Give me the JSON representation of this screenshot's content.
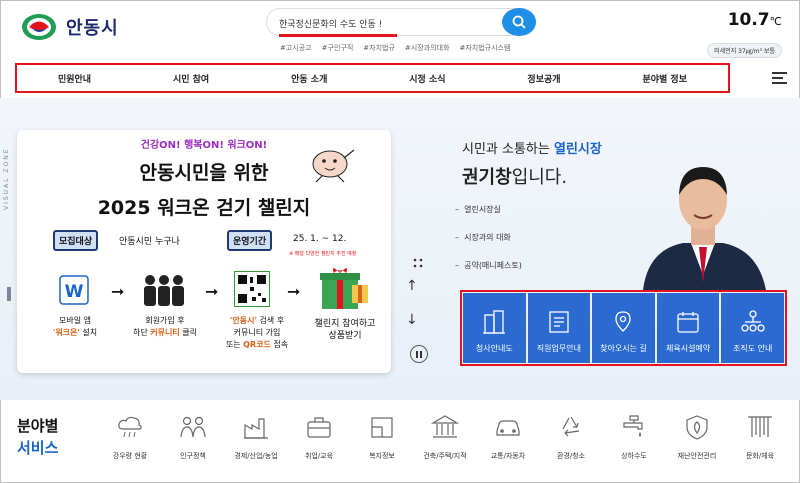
{
  "header": {
    "logo_text": "안동시",
    "search": {
      "value": "한국정신문화의 수도 안동 !"
    },
    "hashtags": [
      "#고시공고",
      "#구인구직",
      "#자치법규",
      "#시장과의대화",
      "#자치법규시스템"
    ],
    "weather": {
      "temperature": "10.7",
      "unit": "℃",
      "dust": "미세먼지 37㎍/m³ 보통"
    }
  },
  "nav": {
    "items": [
      "민원안내",
      "시민 참여",
      "안동 소개",
      "시정 소식",
      "정보공개",
      "분야별 정보"
    ]
  },
  "banner": {
    "kicker": "건강ON! 행복ON! 워크ON!",
    "title1": "안동시민을 위한",
    "title2": "2025 워크온 걷기 챌린지",
    "target_tag": "모집대상",
    "target_value": "안동시민  누구나",
    "period_tag": "운영기간",
    "period_value": "25. 1. ~ 12.",
    "period_note": "※ 매달 다양한 챌린지 추진 예정",
    "steps": [
      {
        "line1": "모바일 앱",
        "line2_hl": "'워크온'",
        "line2": " 설치"
      },
      {
        "line1": "회원가입 후",
        "line2": "하단 ",
        "line2_hl": "커뮤니티",
        "line2_tail": " 클릭"
      },
      {
        "line1_hl": "'안동시'",
        "line1": " 검색 후",
        "line2": "커뮤니티 가입",
        "line3": "또는 ",
        "line3_hl": "QR코드",
        "line3_tail": " 접속"
      },
      {
        "line1": "챌린지 참여하고",
        "line2": "상품받기"
      }
    ],
    "visual_zone": "VISUAL ZONE"
  },
  "mayor": {
    "sub_prefix": "시민과 소통하는 ",
    "sub_highlight": "열린시장",
    "name": "권기창",
    "name_suffix": "입니다.",
    "links": [
      "열린시장실",
      "시장과의 대화",
      "공약(매니페스토)"
    ]
  },
  "quick_links": [
    "청사안내도",
    "직원업무안내",
    "찾아오시는 길",
    "체육시설예약",
    "조직도 안내"
  ],
  "services": {
    "title1": "분야별",
    "title2": "서비스",
    "items": [
      "강우량 현황",
      "인구정책",
      "경제/산업/농업",
      "취업/교육",
      "복지정보",
      "건축/주택/지적",
      "교통/자동차",
      "환경/청소",
      "상하수도",
      "재난안전관리",
      "문화/체육"
    ]
  },
  "colors": {
    "accent": "#1f8fe6",
    "highlight_border": "#e3141b",
    "quick_bg": "#2a6ad1",
    "service_blue": "#1b63c9"
  }
}
